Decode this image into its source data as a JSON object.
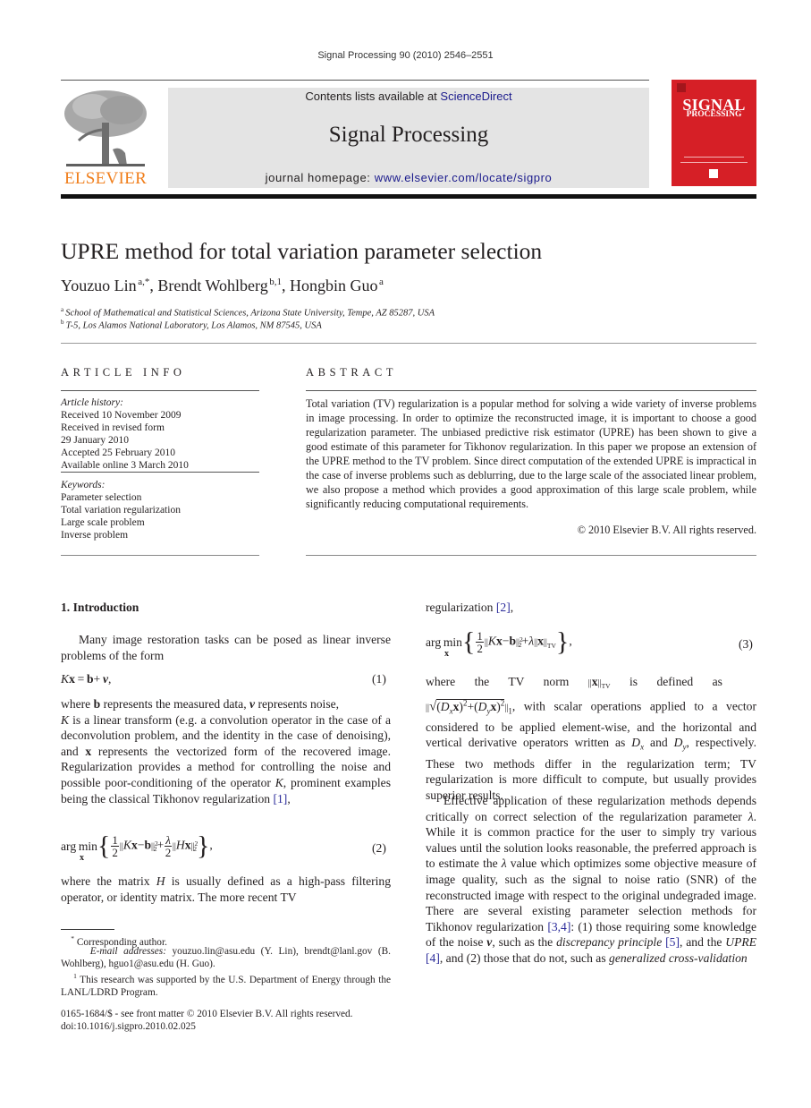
{
  "running_head": "Signal Processing 90 (2010) 2546–2551",
  "masthead": {
    "contents_prefix": "Contents lists available at ",
    "contents_link": "ScienceDirect",
    "journal_name": "Signal Processing",
    "homepage_prefix": "journal homepage: ",
    "homepage_link": "www.elsevier.com/locate/sigpro",
    "publisher_logo_word": "ELSEVIER",
    "cover_title_line1": "SIGNAL",
    "cover_title_line2": "PROCESSING",
    "colors": {
      "publisher_orange": "#f07e1b",
      "cover_red": "#d61f26",
      "link_blue": "#1a1a8c",
      "masthead_gray": "#e4e4e4"
    }
  },
  "article": {
    "title": "UPRE method for total variation parameter selection",
    "authors": [
      {
        "name": "Youzuo Lin",
        "sup": "a,*"
      },
      {
        "name": "Brendt Wohlberg",
        "sup": "b,1"
      },
      {
        "name": "Hongbin Guo",
        "sup": "a"
      }
    ],
    "affiliations": [
      {
        "key": "a",
        "text": "School of Mathematical and Statistical Sciences, Arizona State University, Tempe, AZ 85287, USA"
      },
      {
        "key": "b",
        "text": "T-5, Los Alamos National Laboratory, Los Alamos, NM 87545, USA"
      }
    ]
  },
  "article_info": {
    "heading": "ARTICLE INFO",
    "history_label": "Article history:",
    "history": [
      "Received 10 November 2009",
      "Received in revised form",
      "29 January 2010",
      "Accepted 25 February 2010",
      "Available online 3 March 2010"
    ],
    "keywords_label": "Keywords:",
    "keywords": [
      "Parameter selection",
      "Total variation regularization",
      "Large scale problem",
      "Inverse problem"
    ]
  },
  "abstract": {
    "heading": "ABSTRACT",
    "text": "Total variation (TV) regularization is a popular method for solving a wide variety of inverse problems in image processing. In order to optimize the reconstructed image, it is important to choose a good regularization parameter. The unbiased predictive risk estimator (UPRE) has been shown to give a good estimate of this parameter for Tikhonov regularization. In this paper we propose an extension of the UPRE method to the TV problem. Since direct computation of the extended UPRE is impractical in the case of inverse problems such as deblurring, due to the large scale of the associated linear problem, we also propose a method which provides a good approximation of this large scale problem, while significantly reducing computational requirements.",
    "copyright": "© 2010 Elsevier B.V. All rights reserved."
  },
  "body": {
    "section1_heading": "1.  Introduction",
    "left": {
      "p1": "Many image restoration tasks can be posed as linear inverse problems of the form",
      "eq1_number": "(1)",
      "p2_a": "where ",
      "p2_b": "b",
      "p2_c": " represents the measured data, ",
      "p2_d": "v",
      "p2_e": " represents noise, ",
      "p2_f": "K",
      "p2_g": " is a linear transform (e.g. a convolution operator in the case of a deconvolution problem, and the identity in the case of denoising), and ",
      "p2_h": "x",
      "p2_i": " represents the vectorized form of the recovered image. Regularization provides a method for controlling the noise and possible poor-conditioning of the operator ",
      "p2_j": "K",
      "p2_k": ", prominent examples being the classical Tikhonov regularization ",
      "p2_cite": "[1]",
      "p2_end": ",",
      "eq2_number": "(2)",
      "p3_a": "where the matrix ",
      "p3_b": "H",
      "p3_c": " is usually defined as a high-pass filtering operator, or identity matrix. The more recent TV"
    },
    "right": {
      "p1_a": "regularization ",
      "p1_cite": "[2]",
      "p1_end": ",",
      "eq3_number": "(3)",
      "p2_a": "where the TV norm",
      "p2_b": "is defined as",
      "p2_c": ", with scalar operations applied to a vector considered to be applied element-wise, and the horizontal and vertical derivative operators written as ",
      "p2_d": " and ",
      "p2_e": ", respectively. These two methods differ in the regularization term; TV regularization is more difficult to compute, but usually provides superior results.",
      "p3_a": "Effective application of these regularization methods depends critically on correct selection of the regularization parameter ",
      "p3_b": ". While it is common practice for the user to simply try various values until the solution looks reasonable, the preferred approach is to estimate the ",
      "p3_c": " value which optimizes some objective measure of image quality, such as the signal to noise ratio (SNR) of the reconstructed image with respect to the original undegraded image. There are several existing parameter selection methods for Tikhonov regularization ",
      "p3_cite1": "[3,4]",
      "p3_d": ": (1) those requiring some knowledge of the noise ",
      "p3_e": "v",
      "p3_f": ", such as the ",
      "p3_g": "discrepancy principle",
      "p3_cite2": "[5]",
      "p3_h": ", and the ",
      "p3_i": "UPRE",
      "p3_cite3": "[4]",
      "p3_j": ", and (2) those that do not, such as ",
      "p3_k": "generalized cross-validation"
    }
  },
  "footnotes": {
    "corresponding": "Corresponding author.",
    "email_label": "E-mail addresses:",
    "emails": "youzuo.lin@asu.edu (Y. Lin), brendt@lanl.gov (B. Wohlberg), hguo1@asu.edu (H. Guo).",
    "fn1": "This research was supported by the U.S. Department of Energy through the LANL/LDRD Program.",
    "issn": "0165-1684/$ - see front matter © 2010 Elsevier B.V. All rights reserved.",
    "doi": "doi:10.1016/j.sigpro.2010.02.025"
  }
}
